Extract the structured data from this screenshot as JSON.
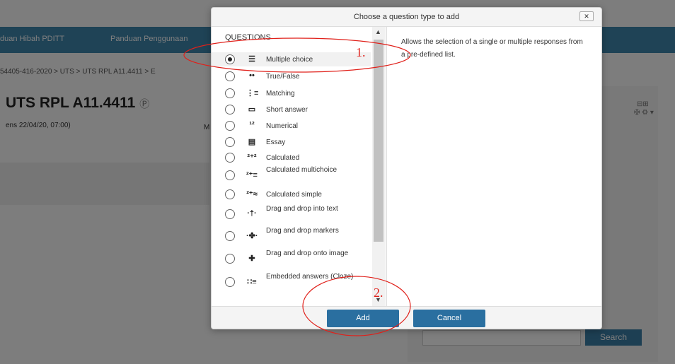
{
  "nav": {
    "item1": "duan Hibah PDITT",
    "item2": "Panduan Penggunaan"
  },
  "breadcrumb": "54405-416-2020 > UTS > UTS RPL A11.4411 > E",
  "page": {
    "title": "UTS RPL A11.4411",
    "help_glyph": "Ⓟ",
    "opens": "ens 22/04/20, 07:00)",
    "letter": "M"
  },
  "block_controls": {
    "top": "⊟⊞",
    "bottom": "✠ ⚙ ▾"
  },
  "search": {
    "button": "Search"
  },
  "dialog": {
    "title": "Choose a question type to add",
    "close": "✕",
    "list_header": "QUESTIONS",
    "description": "Allows the selection of a single or multiple responses from a pre-defined list.",
    "add_label": "Add",
    "cancel_label": "Cancel",
    "scroll_up": "▲",
    "scroll_down": "▼",
    "items": [
      {
        "label": "Multiple choice",
        "icon": "☰",
        "selected": true
      },
      {
        "label": "True/False",
        "icon": "••",
        "selected": false
      },
      {
        "label": "Matching",
        "icon": "⋮≡",
        "selected": false
      },
      {
        "label": "Short answer",
        "icon": "▭",
        "selected": false
      },
      {
        "label": "Numerical",
        "icon": "¹²",
        "selected": false
      },
      {
        "label": "Essay",
        "icon": "▤",
        "selected": false
      },
      {
        "label": "Calculated",
        "icon": "²⁺²",
        "selected": false
      },
      {
        "label": "Calculated multichoice",
        "icon": "²⁺≡",
        "selected": false
      },
      {
        "label": "Calculated simple",
        "icon": "²⁺≈",
        "selected": false
      },
      {
        "label": "Drag and drop into text",
        "icon": "·†·",
        "selected": false
      },
      {
        "label": "Drag and drop markers",
        "icon": "·✤·",
        "selected": false
      },
      {
        "label": "Drag and drop onto image",
        "icon": "✚",
        "selected": false
      },
      {
        "label": "Embedded answers (Cloze)",
        "icon": "∷≡",
        "selected": false
      }
    ]
  },
  "annotations": {
    "step1": "1.",
    "step2": "2.",
    "color": "#e0201a"
  }
}
